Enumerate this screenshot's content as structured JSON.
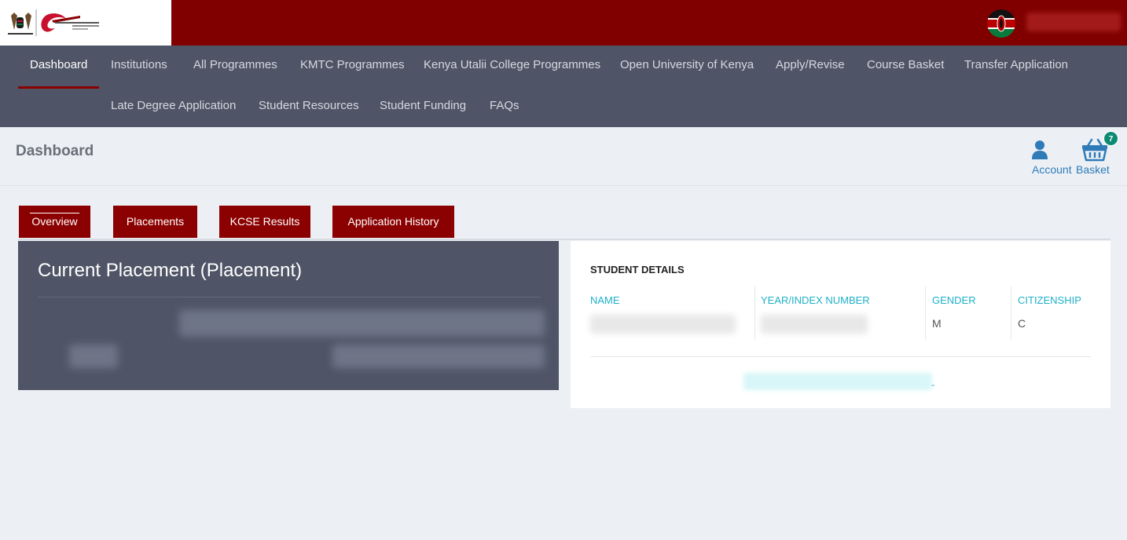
{
  "header": {
    "logo": "kenya-government-and-kuccps-logo",
    "flag_icon": "kenya-flag-icon"
  },
  "nav": {
    "row1": [
      "Dashboard",
      "Institutions",
      "All Programmes",
      "KMTC Programmes",
      "Kenya Utalii College Programmes",
      "Open University of Kenya",
      "Apply/Revise",
      "Course Basket",
      "Transfer Application"
    ],
    "row2": [
      "Late Degree Application",
      "Student Resources",
      "Student Funding",
      "FAQs"
    ],
    "active": "Dashboard"
  },
  "page": {
    "title": "Dashboard",
    "account_label": "Account",
    "basket_label": "Basket",
    "basket_count": "7"
  },
  "tabs": [
    "Overview",
    "Placements",
    "KCSE Results",
    "Application History"
  ],
  "placement": {
    "title": "Current Placement (Placement)"
  },
  "student_details": {
    "heading": "STUDENT DETAILS",
    "columns": [
      "NAME",
      "YEAR/INDEX NUMBER",
      "GENDER",
      "CITIZENSHIP"
    ],
    "gender": "M",
    "citizenship": "C",
    "link_suffix": "-"
  },
  "colors": {
    "brand_red": "#800000",
    "nav_bg": "#4f5566",
    "accent_teal": "#1fb0c8",
    "badge_green": "#0e8a73"
  }
}
